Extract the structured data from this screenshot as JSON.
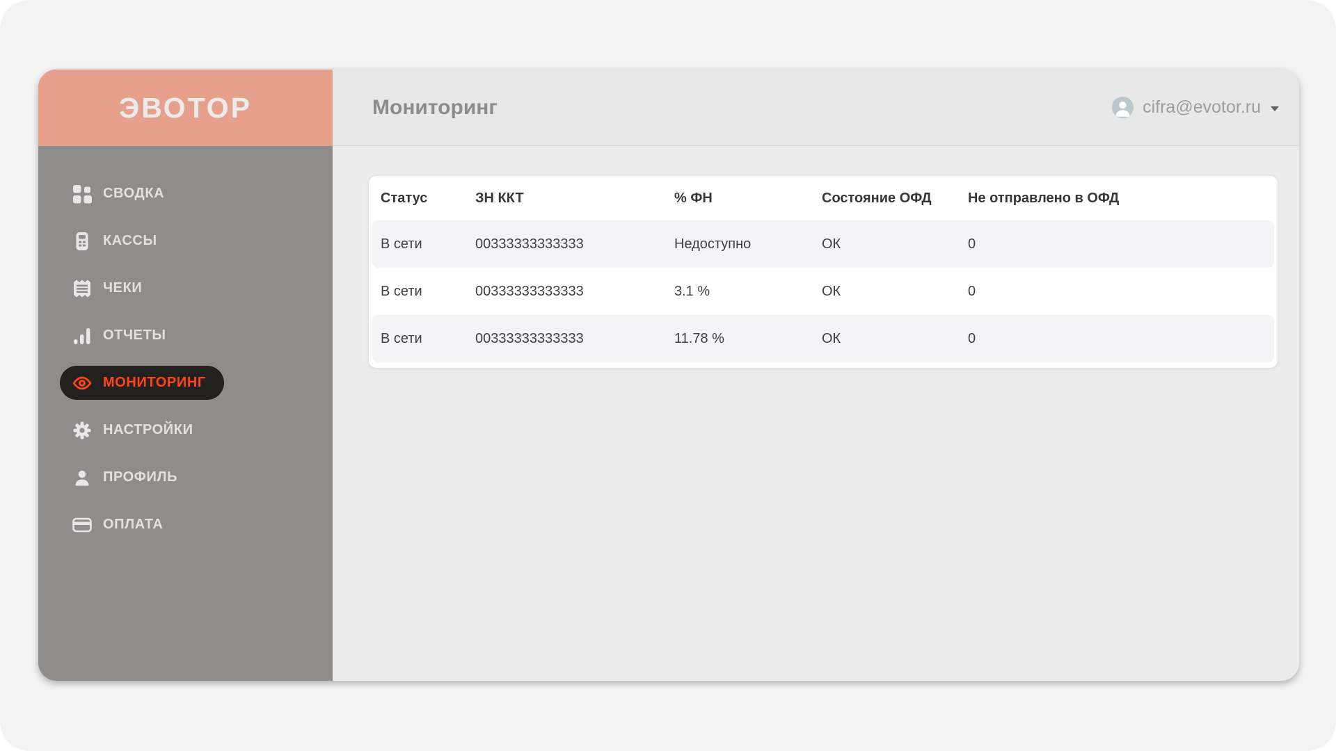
{
  "logo": {
    "text": "ЭВОТОР"
  },
  "header": {
    "title": "Мониторинг",
    "user": {
      "email": "cifra@evotor.ru",
      "avatar_icon": "avatar-icon",
      "menu_icon": "chevron-down-icon"
    }
  },
  "sidebar": {
    "items": [
      {
        "label": "СВОДКА",
        "icon": "dashboard-icon",
        "active": false
      },
      {
        "label": "КАССЫ",
        "icon": "cash-register-icon",
        "active": false
      },
      {
        "label": "ЧЕКИ",
        "icon": "receipt-icon",
        "active": false
      },
      {
        "label": "ОТЧЕТЫ",
        "icon": "bar-chart-icon",
        "active": false
      },
      {
        "label": "МОНИТОРИНГ",
        "icon": "eye-icon",
        "active": true
      },
      {
        "label": "НАСТРОЙКИ",
        "icon": "gear-icon",
        "active": false
      },
      {
        "label": "ПРОФИЛЬ",
        "icon": "person-icon",
        "active": false
      },
      {
        "label": "ОПЛАТА",
        "icon": "credit-card-icon",
        "active": false
      }
    ]
  },
  "monitoring_table": {
    "columns": [
      "Статус",
      "ЗН ККТ",
      "% ФН",
      "Состояние ОФД",
      "Не отправлено в ОФД"
    ],
    "rows": [
      [
        "В сети",
        "00333333333333",
        "Недоступно",
        "ОК",
        "0"
      ],
      [
        "В сети",
        "00333333333333",
        "3.1 %",
        "ОК",
        "0"
      ],
      [
        "В сети",
        "00333333333333",
        "11.78 %",
        "ОК",
        "0"
      ]
    ]
  },
  "colors": {
    "accent_orange": "#ff4517",
    "brand_salmon": "#e6a08c",
    "sidebar_gray": "#8f8c8c",
    "active_pill_black": "#232120",
    "row_stripe": "#f4f4f6",
    "avatar_fill": "#bac7ce"
  }
}
